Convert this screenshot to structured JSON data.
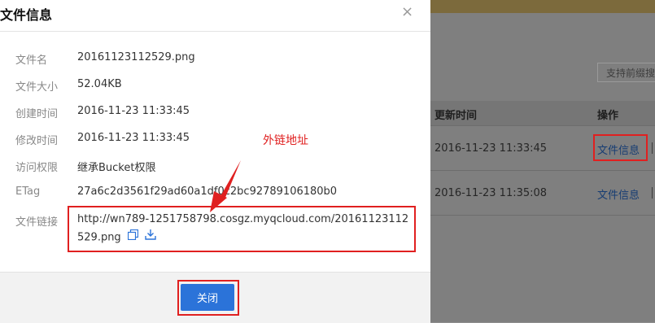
{
  "dialog": {
    "title": "文件信息",
    "close_glyph": "×",
    "fields": [
      {
        "label": "文件名",
        "value": "20161123112529.png"
      },
      {
        "label": "文件大小",
        "value": "52.04KB"
      },
      {
        "label": "创建时间",
        "value": "2016-11-23 11:33:45"
      },
      {
        "label": "修改时间",
        "value": "2016-11-23 11:33:45"
      },
      {
        "label": "访问权限",
        "value": "继承Bucket权限"
      },
      {
        "label": "ETag",
        "value": "27a6c2d3561f29ad60a1df0c2bc92789106180b0"
      }
    ],
    "link_label": "文件链接",
    "link_url": "http://wn789-1251758798.cosgz.myqcloud.com/20161123112529.png",
    "copy_icon": "copy-icon",
    "download_icon": "download-icon",
    "close_button": "关闭"
  },
  "annotation": "外链地址",
  "background": {
    "search_placeholder": "支持前缀搜",
    "columns": {
      "updated": "更新时间",
      "actions": "操作"
    },
    "rows": [
      {
        "updated": "2016-11-23 11:33:45",
        "action": "文件信息"
      },
      {
        "updated": "2016-11-23 11:35:08",
        "action": "文件信息"
      }
    ]
  },
  "colors": {
    "accent": "#2b73d9",
    "highlight": "#e02020"
  }
}
